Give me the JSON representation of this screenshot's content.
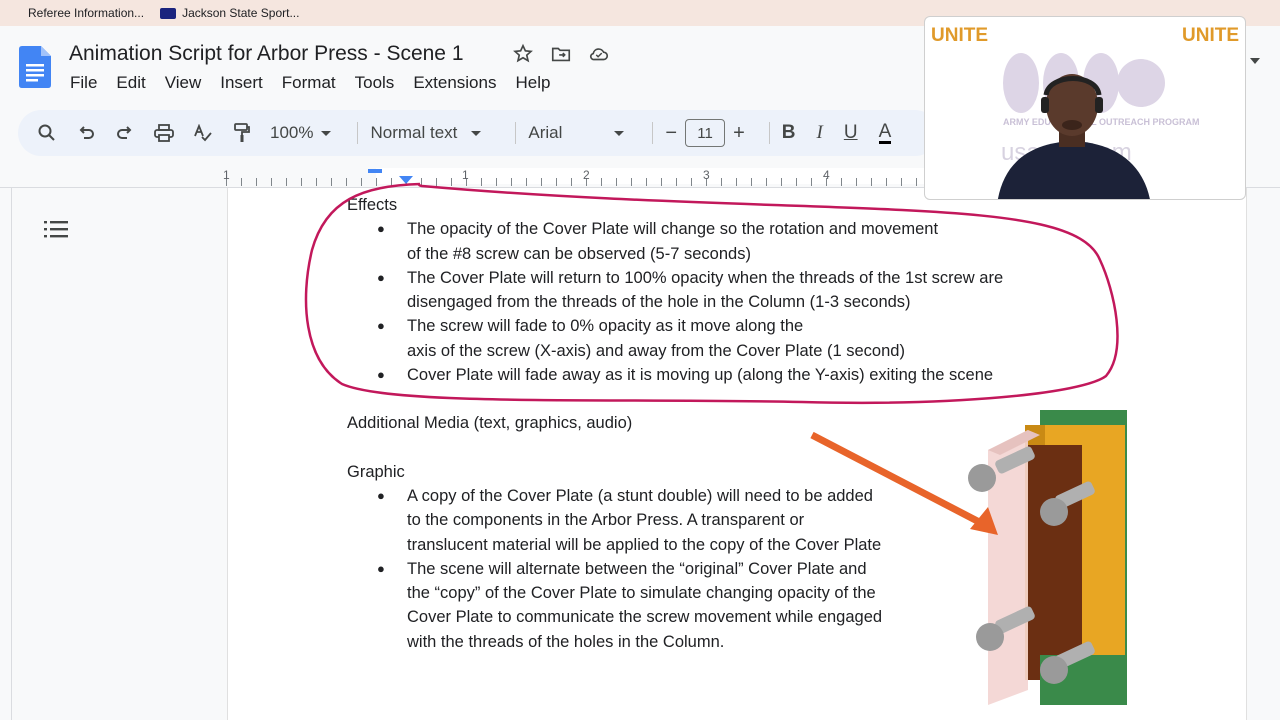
{
  "bookmarks": [
    {
      "label": "Referee Information..."
    },
    {
      "label": "Jackson State Sport..."
    }
  ],
  "document": {
    "title": "Animation Script for Arbor Press - Scene 1"
  },
  "menu": [
    "File",
    "Edit",
    "View",
    "Insert",
    "Format",
    "Tools",
    "Extensions",
    "Help"
  ],
  "toolbar": {
    "zoom": "100%",
    "style": "Normal text",
    "font": "Arial",
    "font_size": "11",
    "minus": "−",
    "plus": "+",
    "bold": "B",
    "italic": "I",
    "underline": "U",
    "text_color": "A"
  },
  "ruler": {
    "marks": [
      "1",
      "1",
      "2",
      "3",
      "4"
    ]
  },
  "content": {
    "effects_heading": "Effects",
    "effects": [
      "The opacity of the Cover Plate will change so the rotation and movement",
      "of the #8 screw can be observed (5-7 seconds)",
      "The Cover Plate will return to 100% opacity when the threads of the 1st screw are",
      "disengaged from the threads of the hole in the Column (1-3 seconds)",
      "The screw will fade to 0% opacity as it move along the",
      "axis of the screw (X-axis) and away from the Cover Plate (1 second)",
      "Cover Plate will fade away as it is moving up (along the Y-axis) exiting the scene"
    ],
    "media_heading": "Additional Media (text, graphics, audio)",
    "graphic_heading": "Graphic",
    "graphic": [
      "A copy of the Cover Plate (a stunt double) will need to be added",
      "to the components in the Arbor Press. A transparent or",
      "translucent material will be applied to the copy of the Cover Plate",
      "The scene will alternate between the “original” Cover Plate and",
      "the “copy” of the Cover Plate to simulate changing opacity of the",
      "Cover Plate to communicate the screw movement while engaged",
      "with the threads of the holes in the Column."
    ]
  },
  "webcam": {
    "logo_left": "UNITE",
    "logo_right": "UNITE",
    "watermark_org": "ARMY EDUCATIONAL OUTREACH PROGRAM",
    "watermark_url": "usaeop.com"
  },
  "colors": {
    "annotation": "#c2185b",
    "arrow": "#e8642a",
    "docs_blue": "#4285f4"
  }
}
